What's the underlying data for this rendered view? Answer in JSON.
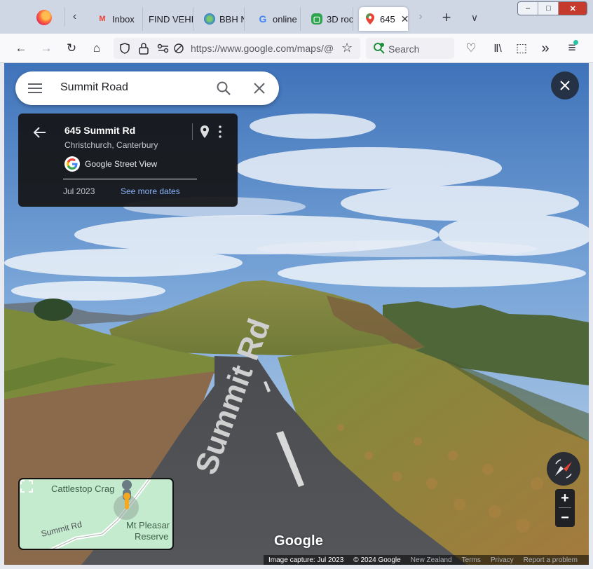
{
  "browser": {
    "tabs": [
      {
        "label": "Inbox",
        "favicon": "gmail-icon",
        "color": "#ea4335"
      },
      {
        "label": "FIND VEHI",
        "favicon": "none",
        "color": "#888888"
      },
      {
        "label": "BBH N",
        "favicon": "globe-icon",
        "color": "#2d7dd2"
      },
      {
        "label": "online",
        "favicon": "google-icon",
        "color": "#4285f4"
      },
      {
        "label": "3D roc",
        "favicon": "app-icon",
        "color": "#2ea44f"
      },
      {
        "label": "645",
        "favicon": "google-maps-pin-icon",
        "color": "#ea4335",
        "active": true
      }
    ],
    "url": "https://www.google.com/maps/@-",
    "search_placeholder": "Search",
    "window_controls": {
      "minimize": "–",
      "restore": "□",
      "close": "✕"
    }
  },
  "maps": {
    "search_query": "Summit Road",
    "card": {
      "title": "645 Summit Rd",
      "subtitle": "Christchurch, Canterbury",
      "source": "Google Street View",
      "date": "Jul 2023",
      "more_dates": "See more dates"
    },
    "minimap": {
      "labels": {
        "crag": "Cattlestop Crag",
        "road": "Summit Rd",
        "mt_pleasant": "Mt Pleasar",
        "reserve": "Reserve"
      }
    },
    "watermark": "Google",
    "road_marking": "Summit Rd",
    "attribution": {
      "capture": "Image capture: Jul 2023",
      "copyright": "© 2024 Google",
      "country": "New Zealand",
      "terms": "Terms",
      "privacy": "Privacy",
      "report": "Report a problem"
    },
    "zoom": {
      "in": "+",
      "out": "−"
    }
  },
  "colors": {
    "close_button": "#253245",
    "card_bg": "#141416",
    "link": "#8ab4f8",
    "compass_needle": "#ea4335"
  }
}
